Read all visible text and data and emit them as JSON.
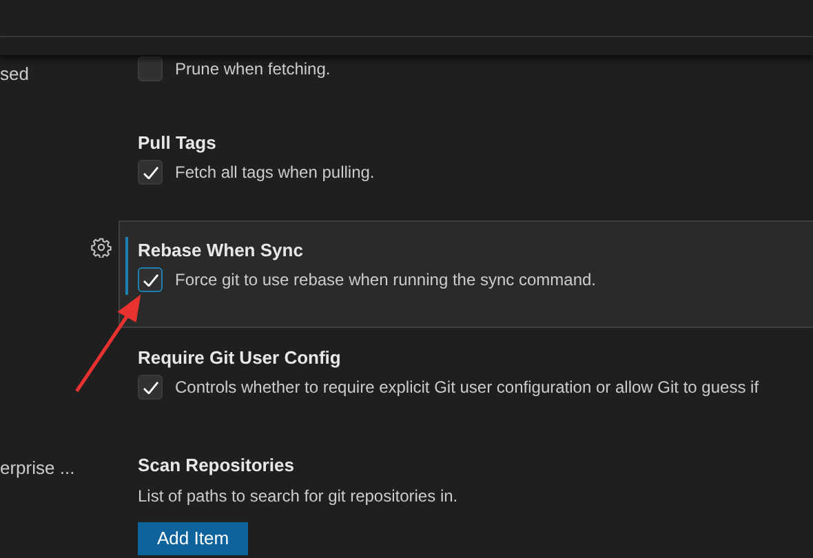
{
  "toc": [
    {
      "label": "sed"
    },
    {
      "label": "erprise ..."
    }
  ],
  "settings": [
    {
      "kind": "checkbox",
      "description": "Prune when fetching.",
      "checked": false,
      "focused": false
    },
    {
      "kind": "checkbox",
      "title": "Pull Tags",
      "description": "Fetch all tags when pulling.",
      "checked": true,
      "focused": false
    },
    {
      "kind": "checkbox",
      "title": "Rebase When Sync",
      "description": "Force git to use rebase when running the sync command.",
      "checked": true,
      "focused": true
    },
    {
      "kind": "checkbox",
      "title": "Require Git User Config",
      "description": "Controls whether to require explicit Git user configuration or allow Git to guess if",
      "checked": true,
      "focused": false
    },
    {
      "kind": "list",
      "title": "Scan Repositories",
      "description": "List of paths to search for git repositories in.",
      "button": "Add Item",
      "focused": false
    }
  ]
}
